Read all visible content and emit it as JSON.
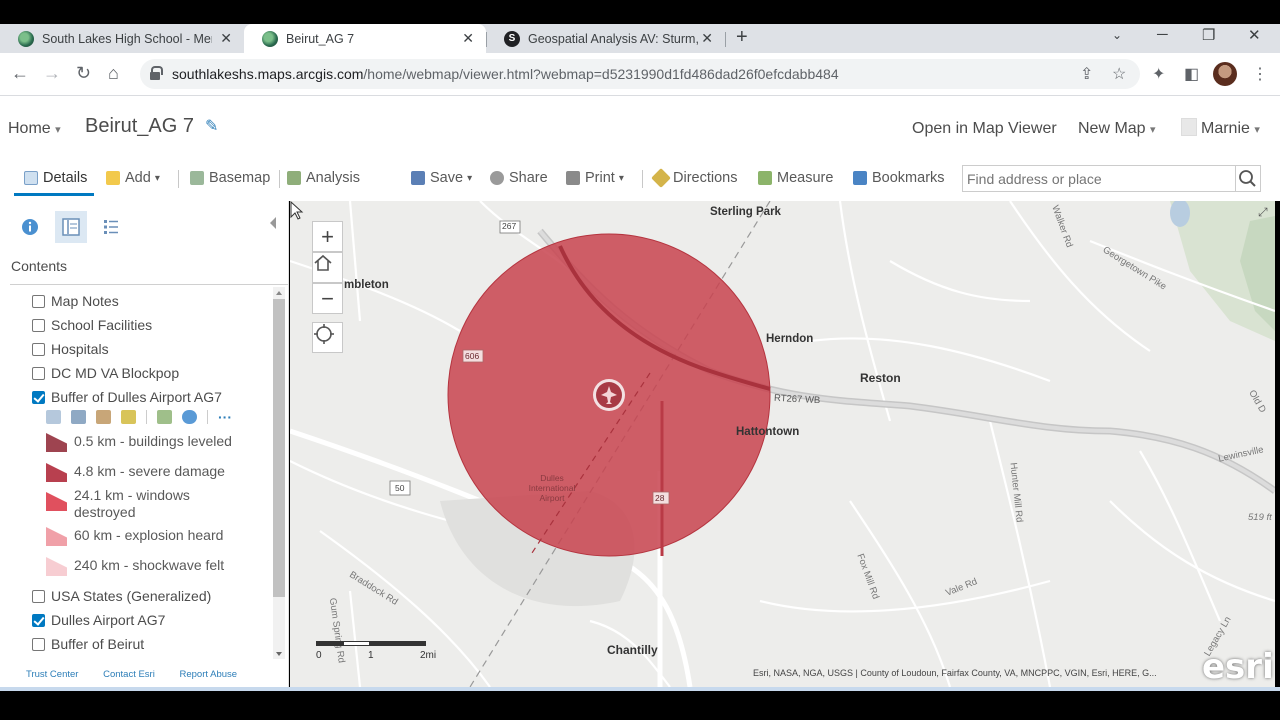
{
  "browser": {
    "tabs": [
      {
        "title": "South Lakes High School - Mem"
      },
      {
        "title": "Beirut_AG 7"
      },
      {
        "title": "Geospatial Analysis AV: Sturm, M"
      }
    ],
    "url_host": "southlakeshs.maps.arcgis.com",
    "url_path": "/home/webmap/viewer.html?webmap=d5231990d1fd486dad26f0efcdabb484"
  },
  "header": {
    "home": "Home",
    "map_title": "Beirut_AG 7",
    "open_viewer": "Open in Map Viewer",
    "new_map": "New Map",
    "user": "Marnie"
  },
  "toolbar": {
    "details": "Details",
    "add": "Add",
    "basemap": "Basemap",
    "analysis": "Analysis",
    "save": "Save",
    "share": "Share",
    "print": "Print",
    "directions": "Directions",
    "measure": "Measure",
    "bookmarks": "Bookmarks",
    "search_placeholder": "Find address or place"
  },
  "panel": {
    "contents_title": "Contents",
    "layers": [
      {
        "label": "Map Notes",
        "checked": false
      },
      {
        "label": "School Facilities",
        "checked": false
      },
      {
        "label": "Hospitals",
        "checked": false
      },
      {
        "label": "DC MD VA Blockpop",
        "checked": false
      },
      {
        "label": "Buffer of Dulles Airport AG7",
        "checked": true
      },
      {
        "label": "USA States (Generalized)",
        "checked": false
      },
      {
        "label": "Dulles Airport AG7",
        "checked": true
      },
      {
        "label": "Buffer of Beirut",
        "checked": false
      }
    ],
    "legend": [
      {
        "label": "0.5 km - buildings leveled",
        "color": "#9e4450"
      },
      {
        "label": "4.8 km - severe damage",
        "color": "#b8404f"
      },
      {
        "label": "24.1 km - windows destroyed",
        "color": "#e0505e"
      },
      {
        "label": "60 km - explosion heard",
        "color": "#f0a0a8"
      },
      {
        "label": "240 km - shockwave felt",
        "color": "#f7cdd2"
      }
    ],
    "footer": [
      "Trust Center",
      "Contact Esri",
      "Report Abuse"
    ]
  },
  "map": {
    "places": {
      "sterling_park": "Sterling Park",
      "herndon": "Herndon",
      "reston": "Reston",
      "hattontown": "Hattontown",
      "chantilly": "Chantilly",
      "dulles": "Dulles International Airport",
      "mbleton": "mbleton"
    },
    "roads": {
      "r267": "267",
      "r606": "606",
      "r50": "50",
      "r28": "28",
      "rt267": "RT267 WB",
      "walker": "Walker Rd",
      "georgetown": "Georgetown Pike",
      "oldd": "Old D",
      "lewinsville": "Lewinsville",
      "hunter": "Hunter Mill Rd",
      "fox": "Fox Mill Rd",
      "vale": "Vale Rd",
      "braddock": "Braddock Rd",
      "gumspring": "Gum Spring Rd",
      "legacy": "Legacy Ln",
      "elev": "519 ft"
    },
    "scale": [
      "0",
      "1",
      "2mi"
    ],
    "attribution": "Esri, NASA, NGA, USGS | County of Loudoun, Fairfax County, VA, MNCPPC, VGIN, Esri, HERE, G...",
    "logo": "esri",
    "buffer_color": "#c8434f"
  }
}
